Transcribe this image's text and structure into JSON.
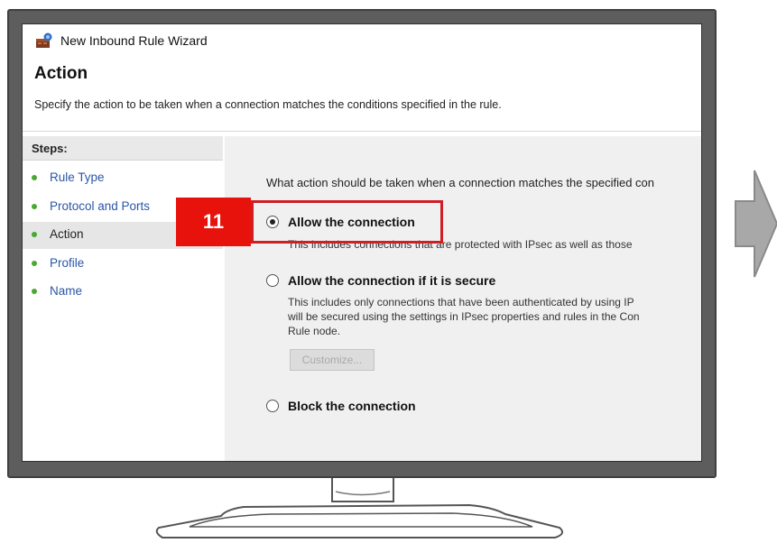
{
  "window": {
    "title": "New Inbound Rule Wizard",
    "icon": "firewall-rule-icon"
  },
  "page": {
    "heading": "Action",
    "description": "Specify the action to be taken when a connection matches the conditions specified in the rule."
  },
  "steps": {
    "title": "Steps:",
    "items": [
      {
        "label": "Rule Type",
        "active": false
      },
      {
        "label": "Protocol and Ports",
        "active": false
      },
      {
        "label": "Action",
        "active": true
      },
      {
        "label": "Profile",
        "active": false
      },
      {
        "label": "Name",
        "active": false
      }
    ]
  },
  "content": {
    "question": "What action should be taken when a connection matches the specified con",
    "options": [
      {
        "label": "Allow the connection",
        "selected": true,
        "description": "This includes connections that are protected with IPsec as well as those"
      },
      {
        "label": "Allow the connection if it is secure",
        "selected": false,
        "description_lines": [
          "This includes only connections that have been authenticated by using IP",
          "will be secured using the settings in IPsec properties and rules in the Con",
          "Rule node."
        ]
      },
      {
        "label": "Block the connection",
        "selected": false
      }
    ],
    "customize_button": "Customize..."
  },
  "callout": {
    "number": "11",
    "color": "#e8120c"
  },
  "colors": {
    "step_link": "#2a56a6",
    "step_bullet": "#4aa832",
    "monitor_bezel": "#5d5d5d",
    "next_arrow": "#a8a8a8"
  }
}
